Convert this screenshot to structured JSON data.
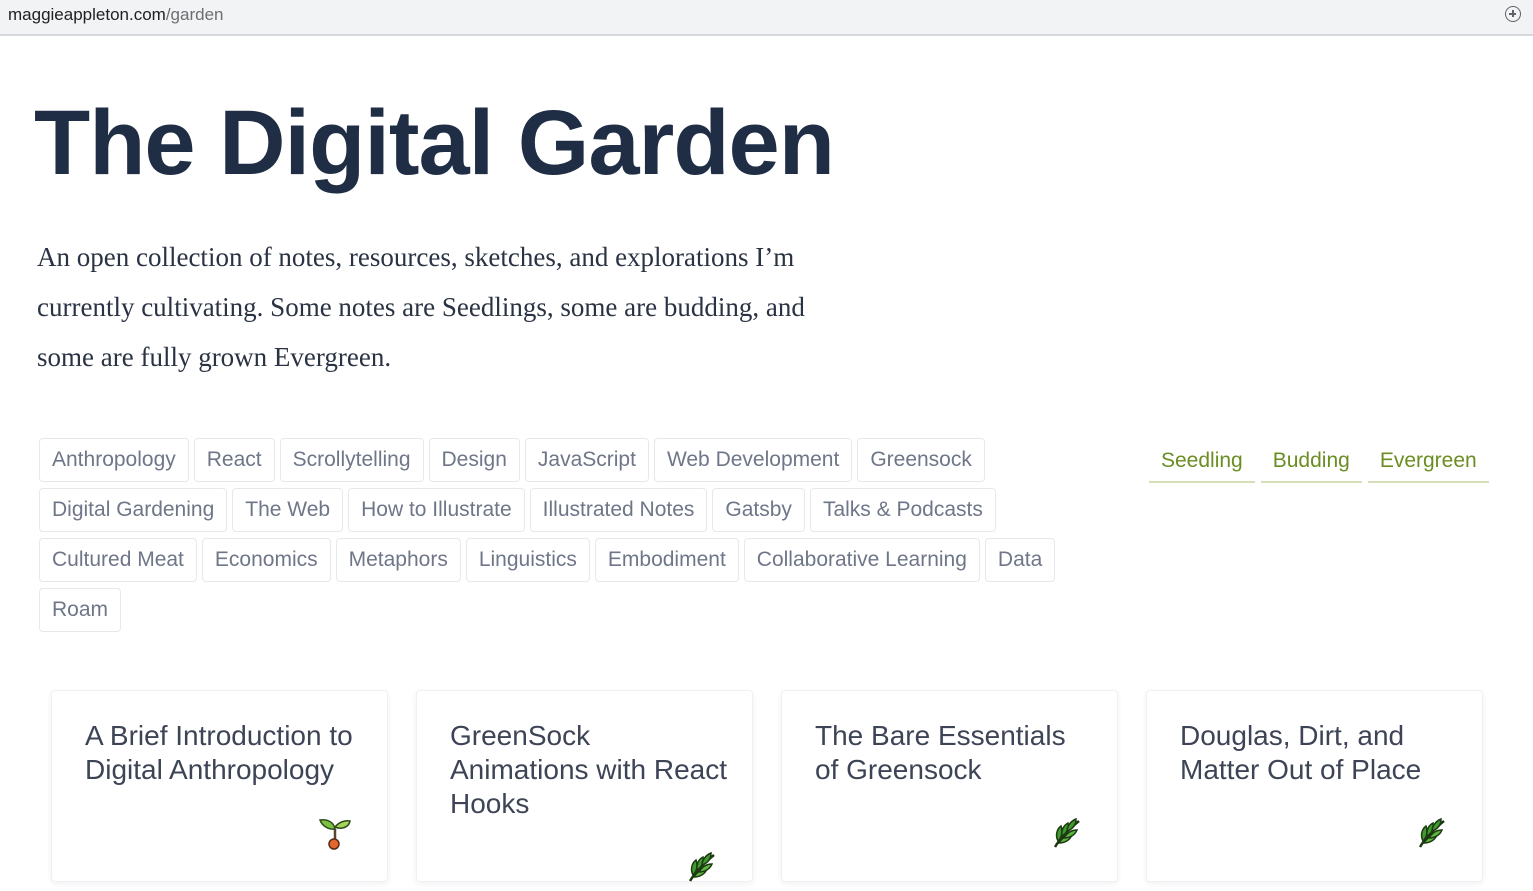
{
  "browser": {
    "url_domain": "maggieappleton.com",
    "url_path": "/garden"
  },
  "page": {
    "title": "The Digital Garden",
    "intro_line1": "An open collection of notes, resources, sketches, and explorations I’m",
    "intro_line2": "currently cultivating. Some notes are Seedlings, some are budding, and",
    "intro_line3": "some are fully grown Evergreen."
  },
  "tags": {
    "row1": [
      "Anthropology",
      "React",
      "Scrollytelling",
      "Design",
      "JavaScript",
      "Web Development",
      "Greensock"
    ],
    "row2": [
      "Digital Gardening",
      "The Web",
      "How to Illustrate",
      "Illustrated Notes",
      "Gatsby",
      "Talks & Podcasts"
    ],
    "row3": [
      "Cultured Meat",
      "Economics",
      "Metaphors",
      "Linguistics",
      "Embodiment",
      "Collaborative Learning",
      "Data"
    ],
    "row4": [
      "Roam"
    ]
  },
  "stages": [
    "Seedling",
    "Budding",
    "Evergreen"
  ],
  "colors": {
    "title": "#1f2d45",
    "stage_accent": "#6b8e23",
    "tag_text": "#6e7688"
  },
  "cards": [
    {
      "title": "A Brief Introduction to Digital Anthropology",
      "icon": "seedling-icon"
    },
    {
      "title": "GreenSock Animations with React Hooks",
      "icon": "evergreen-leaf-icon"
    },
    {
      "title": "The Bare Essentials of Greensock",
      "icon": "evergreen-leaf-icon"
    },
    {
      "title": "Douglas, Dirt, and Matter Out of Place",
      "icon": "evergreen-leaf-icon"
    }
  ]
}
